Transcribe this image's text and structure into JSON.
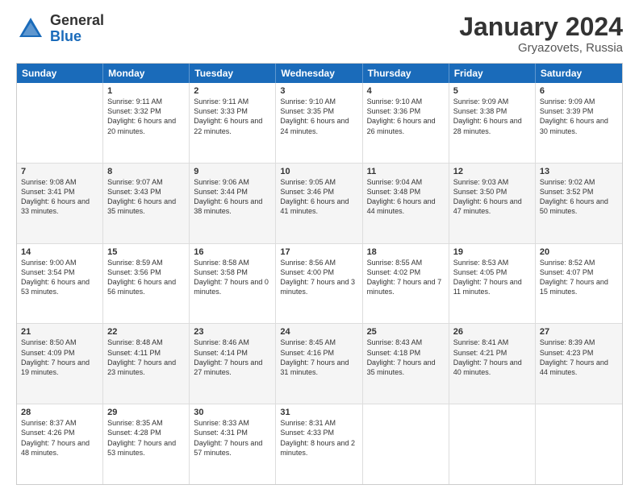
{
  "logo": {
    "general": "General",
    "blue": "Blue"
  },
  "title": "January 2024",
  "location": "Gryazovets, Russia",
  "weekdays": [
    "Sunday",
    "Monday",
    "Tuesday",
    "Wednesday",
    "Thursday",
    "Friday",
    "Saturday"
  ],
  "rows": [
    [
      {
        "day": "",
        "sunrise": "",
        "sunset": "",
        "daylight": ""
      },
      {
        "day": "1",
        "sunrise": "Sunrise: 9:11 AM",
        "sunset": "Sunset: 3:32 PM",
        "daylight": "Daylight: 6 hours and 20 minutes."
      },
      {
        "day": "2",
        "sunrise": "Sunrise: 9:11 AM",
        "sunset": "Sunset: 3:33 PM",
        "daylight": "Daylight: 6 hours and 22 minutes."
      },
      {
        "day": "3",
        "sunrise": "Sunrise: 9:10 AM",
        "sunset": "Sunset: 3:35 PM",
        "daylight": "Daylight: 6 hours and 24 minutes."
      },
      {
        "day": "4",
        "sunrise": "Sunrise: 9:10 AM",
        "sunset": "Sunset: 3:36 PM",
        "daylight": "Daylight: 6 hours and 26 minutes."
      },
      {
        "day": "5",
        "sunrise": "Sunrise: 9:09 AM",
        "sunset": "Sunset: 3:38 PM",
        "daylight": "Daylight: 6 hours and 28 minutes."
      },
      {
        "day": "6",
        "sunrise": "Sunrise: 9:09 AM",
        "sunset": "Sunset: 3:39 PM",
        "daylight": "Daylight: 6 hours and 30 minutes."
      }
    ],
    [
      {
        "day": "7",
        "sunrise": "Sunrise: 9:08 AM",
        "sunset": "Sunset: 3:41 PM",
        "daylight": "Daylight: 6 hours and 33 minutes."
      },
      {
        "day": "8",
        "sunrise": "Sunrise: 9:07 AM",
        "sunset": "Sunset: 3:43 PM",
        "daylight": "Daylight: 6 hours and 35 minutes."
      },
      {
        "day": "9",
        "sunrise": "Sunrise: 9:06 AM",
        "sunset": "Sunset: 3:44 PM",
        "daylight": "Daylight: 6 hours and 38 minutes."
      },
      {
        "day": "10",
        "sunrise": "Sunrise: 9:05 AM",
        "sunset": "Sunset: 3:46 PM",
        "daylight": "Daylight: 6 hours and 41 minutes."
      },
      {
        "day": "11",
        "sunrise": "Sunrise: 9:04 AM",
        "sunset": "Sunset: 3:48 PM",
        "daylight": "Daylight: 6 hours and 44 minutes."
      },
      {
        "day": "12",
        "sunrise": "Sunrise: 9:03 AM",
        "sunset": "Sunset: 3:50 PM",
        "daylight": "Daylight: 6 hours and 47 minutes."
      },
      {
        "day": "13",
        "sunrise": "Sunrise: 9:02 AM",
        "sunset": "Sunset: 3:52 PM",
        "daylight": "Daylight: 6 hours and 50 minutes."
      }
    ],
    [
      {
        "day": "14",
        "sunrise": "Sunrise: 9:00 AM",
        "sunset": "Sunset: 3:54 PM",
        "daylight": "Daylight: 6 hours and 53 minutes."
      },
      {
        "day": "15",
        "sunrise": "Sunrise: 8:59 AM",
        "sunset": "Sunset: 3:56 PM",
        "daylight": "Daylight: 6 hours and 56 minutes."
      },
      {
        "day": "16",
        "sunrise": "Sunrise: 8:58 AM",
        "sunset": "Sunset: 3:58 PM",
        "daylight": "Daylight: 7 hours and 0 minutes."
      },
      {
        "day": "17",
        "sunrise": "Sunrise: 8:56 AM",
        "sunset": "Sunset: 4:00 PM",
        "daylight": "Daylight: 7 hours and 3 minutes."
      },
      {
        "day": "18",
        "sunrise": "Sunrise: 8:55 AM",
        "sunset": "Sunset: 4:02 PM",
        "daylight": "Daylight: 7 hours and 7 minutes."
      },
      {
        "day": "19",
        "sunrise": "Sunrise: 8:53 AM",
        "sunset": "Sunset: 4:05 PM",
        "daylight": "Daylight: 7 hours and 11 minutes."
      },
      {
        "day": "20",
        "sunrise": "Sunrise: 8:52 AM",
        "sunset": "Sunset: 4:07 PM",
        "daylight": "Daylight: 7 hours and 15 minutes."
      }
    ],
    [
      {
        "day": "21",
        "sunrise": "Sunrise: 8:50 AM",
        "sunset": "Sunset: 4:09 PM",
        "daylight": "Daylight: 7 hours and 19 minutes."
      },
      {
        "day": "22",
        "sunrise": "Sunrise: 8:48 AM",
        "sunset": "Sunset: 4:11 PM",
        "daylight": "Daylight: 7 hours and 23 minutes."
      },
      {
        "day": "23",
        "sunrise": "Sunrise: 8:46 AM",
        "sunset": "Sunset: 4:14 PM",
        "daylight": "Daylight: 7 hours and 27 minutes."
      },
      {
        "day": "24",
        "sunrise": "Sunrise: 8:45 AM",
        "sunset": "Sunset: 4:16 PM",
        "daylight": "Daylight: 7 hours and 31 minutes."
      },
      {
        "day": "25",
        "sunrise": "Sunrise: 8:43 AM",
        "sunset": "Sunset: 4:18 PM",
        "daylight": "Daylight: 7 hours and 35 minutes."
      },
      {
        "day": "26",
        "sunrise": "Sunrise: 8:41 AM",
        "sunset": "Sunset: 4:21 PM",
        "daylight": "Daylight: 7 hours and 40 minutes."
      },
      {
        "day": "27",
        "sunrise": "Sunrise: 8:39 AM",
        "sunset": "Sunset: 4:23 PM",
        "daylight": "Daylight: 7 hours and 44 minutes."
      }
    ],
    [
      {
        "day": "28",
        "sunrise": "Sunrise: 8:37 AM",
        "sunset": "Sunset: 4:26 PM",
        "daylight": "Daylight: 7 hours and 48 minutes."
      },
      {
        "day": "29",
        "sunrise": "Sunrise: 8:35 AM",
        "sunset": "Sunset: 4:28 PM",
        "daylight": "Daylight: 7 hours and 53 minutes."
      },
      {
        "day": "30",
        "sunrise": "Sunrise: 8:33 AM",
        "sunset": "Sunset: 4:31 PM",
        "daylight": "Daylight: 7 hours and 57 minutes."
      },
      {
        "day": "31",
        "sunrise": "Sunrise: 8:31 AM",
        "sunset": "Sunset: 4:33 PM",
        "daylight": "Daylight: 8 hours and 2 minutes."
      },
      {
        "day": "",
        "sunrise": "",
        "sunset": "",
        "daylight": ""
      },
      {
        "day": "",
        "sunrise": "",
        "sunset": "",
        "daylight": ""
      },
      {
        "day": "",
        "sunrise": "",
        "sunset": "",
        "daylight": ""
      }
    ]
  ]
}
